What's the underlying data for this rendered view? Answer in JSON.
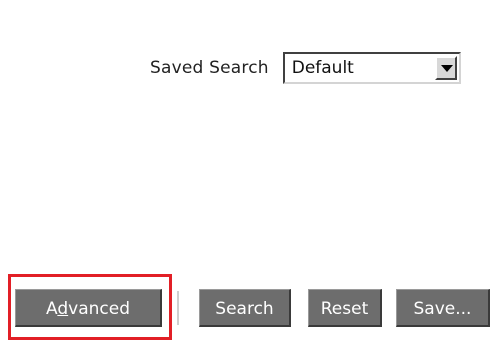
{
  "saved_search": {
    "label": "Saved Search",
    "selected": "Default"
  },
  "buttons": {
    "advanced_pre": "A",
    "advanced_mnemonic": "d",
    "advanced_post": "vanced",
    "search": "Search",
    "reset": "Reset",
    "save": "Save..."
  },
  "colors": {
    "button_bg": "#6d6d6d",
    "highlight": "#e21f26"
  }
}
